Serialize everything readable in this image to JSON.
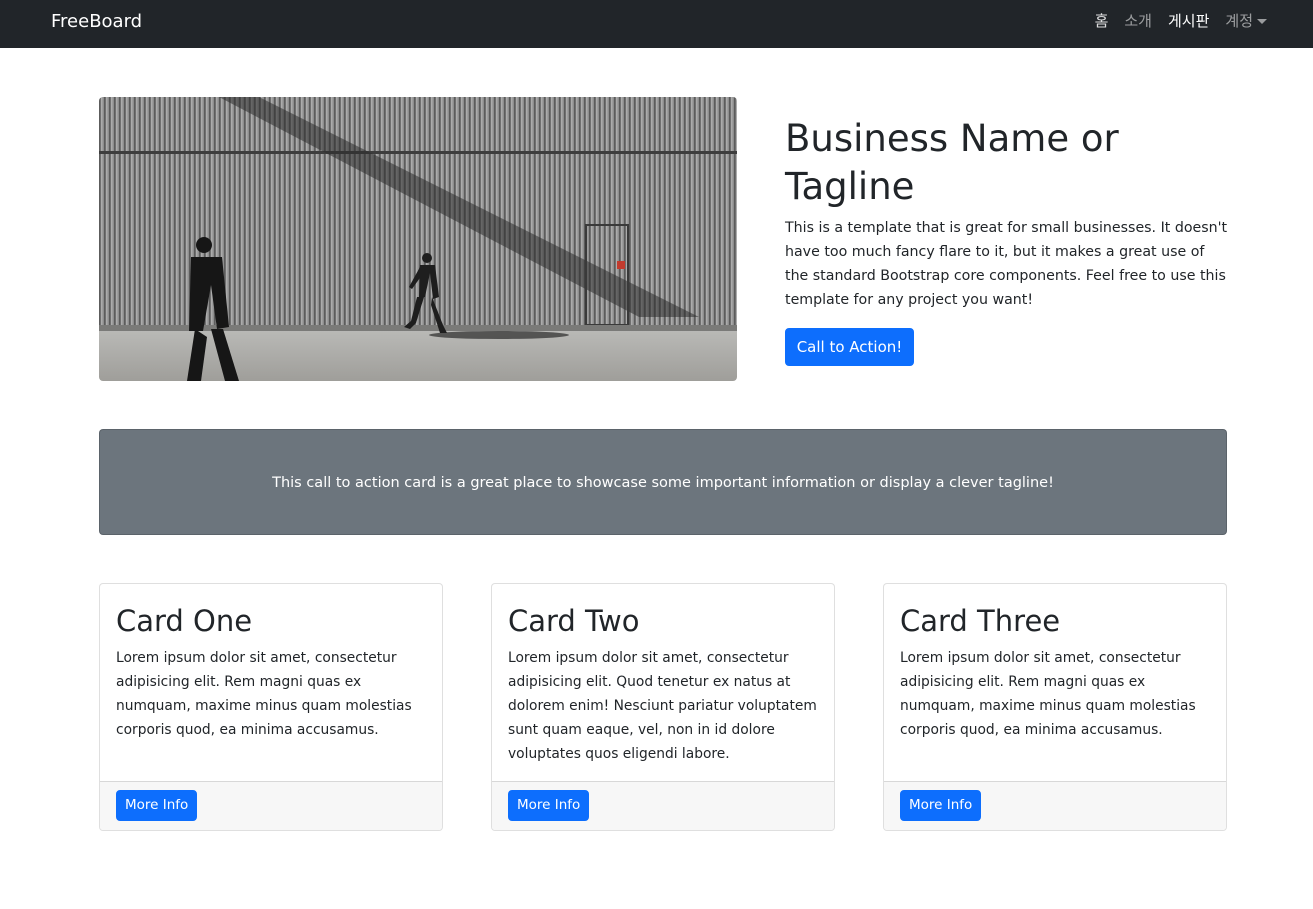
{
  "navbar": {
    "brand": "FreeBoard",
    "items": [
      {
        "label": "홈"
      },
      {
        "label": "소개"
      },
      {
        "label": "게시판"
      },
      {
        "label": "계정"
      }
    ]
  },
  "hero": {
    "image_alt": "photo-of-two-men-walking-past-corrugated-metal-wall",
    "title": "Business Name or Tagline",
    "text": "This is a template that is great for small businesses. It doesn't have too much fancy flare to it, but it makes a great use of the standard Bootstrap core components. Feel free to use this template for any project you want!",
    "button_label": "Call to Action!"
  },
  "cta_card": {
    "text": "This call to action card is a great place to showcase some important information or display a clever tagline!"
  },
  "cards": [
    {
      "title": "Card One",
      "text": "Lorem ipsum dolor sit amet, consectetur adipisicing elit. Rem magni quas ex numquam, maxime minus quam molestias corporis quod, ea minima accusamus.",
      "button_label": "More Info"
    },
    {
      "title": "Card Two",
      "text": "Lorem ipsum dolor sit amet, consectetur adipisicing elit. Quod tenetur ex natus at dolorem enim! Nesciunt pariatur voluptatem sunt quam eaque, vel, non in id dolore voluptates quos eligendi labore.",
      "button_label": "More Info"
    },
    {
      "title": "Card Three",
      "text": "Lorem ipsum dolor sit amet, consectetur adipisicing elit. Rem magni quas ex numquam, maxime minus quam molestias corporis quod, ea minima accusamus.",
      "button_label": "More Info"
    }
  ],
  "colors": {
    "navbar_bg": "#212529",
    "primary": "#0d6efd",
    "cta_card_bg": "#6c757d",
    "card_footer_bg": "#f7f7f7"
  }
}
